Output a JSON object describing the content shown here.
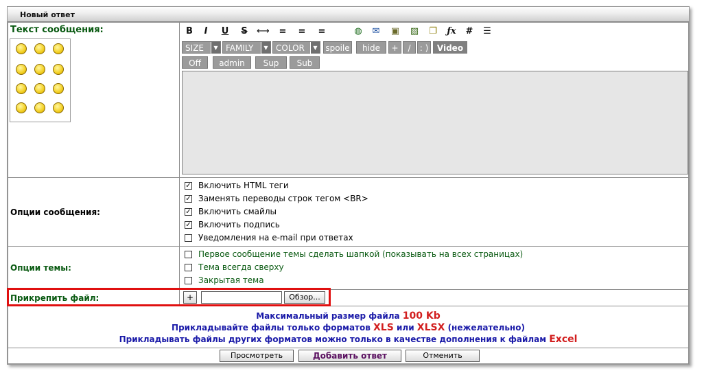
{
  "title": "Новый ответ",
  "labels": {
    "message_text": "Текст сообщения:",
    "message_options": "Опции сообщения:",
    "topic_options": "Опции темы:",
    "attach_file": "Прикрепить файл:"
  },
  "toolbar": {
    "icons": [
      "bold-icon",
      "italic-icon",
      "underline-icon",
      "strike-icon",
      "hr-icon",
      "align-left-icon",
      "align-center-icon",
      "align-right-icon",
      "link-icon",
      "email-icon",
      "image-icon",
      "picture-icon",
      "quote-icon",
      "formula-icon",
      "hash-icon",
      "table-icon"
    ],
    "size": "SIZE",
    "family": "FAMILY",
    "color": "COLOR",
    "spoiler": "spoile",
    "hide": "hide",
    "plus": "+",
    "slash": "/",
    "smile": ": )",
    "video": "Video",
    "off": "Off",
    "admin": "admin",
    "sup": "Sup",
    "sub": "Sub"
  },
  "message_options": [
    {
      "label": "Включить HTML теги",
      "checked": true
    },
    {
      "label": "Заменять переводы строк тегом <BR>",
      "checked": true
    },
    {
      "label": "Включить смайлы",
      "checked": true
    },
    {
      "label": "Включить подпись",
      "checked": true
    },
    {
      "label": "Уведомления на e-mail при ответах",
      "checked": false
    }
  ],
  "topic_options": [
    {
      "label": "Первое сообщение темы сделать шапкой (показывать на всех страницах)",
      "checked": false
    },
    {
      "label": "Тема всегда сверху",
      "checked": false
    },
    {
      "label": "Закрытая тема",
      "checked": false
    }
  ],
  "attach": {
    "plus": "+",
    "browse": "Обзор...",
    "value": ""
  },
  "info": {
    "line1_pre": "Максимальный размер файла ",
    "line1_red": "100 Kb",
    "line2_pre": "Прикладывайте файлы только форматов ",
    "line2_red1": "XLS",
    "line2_mid": " или ",
    "line2_red2": "XLSX",
    "line2_post": " (нежелательно)",
    "line3_pre": "Прикладывать файлы других форматов можно только в качестве дополнения к файлам ",
    "line3_red": "Excel"
  },
  "buttons": {
    "preview": "Просмотреть",
    "submit": "Добавить ответ",
    "cancel": "Отменить"
  },
  "colors": {
    "label_green": "#0a5a12",
    "info_blue": "#1a1aa8",
    "info_red": "#d21e1e",
    "highlight": "#e01010",
    "submit_text": "#5a1060"
  }
}
